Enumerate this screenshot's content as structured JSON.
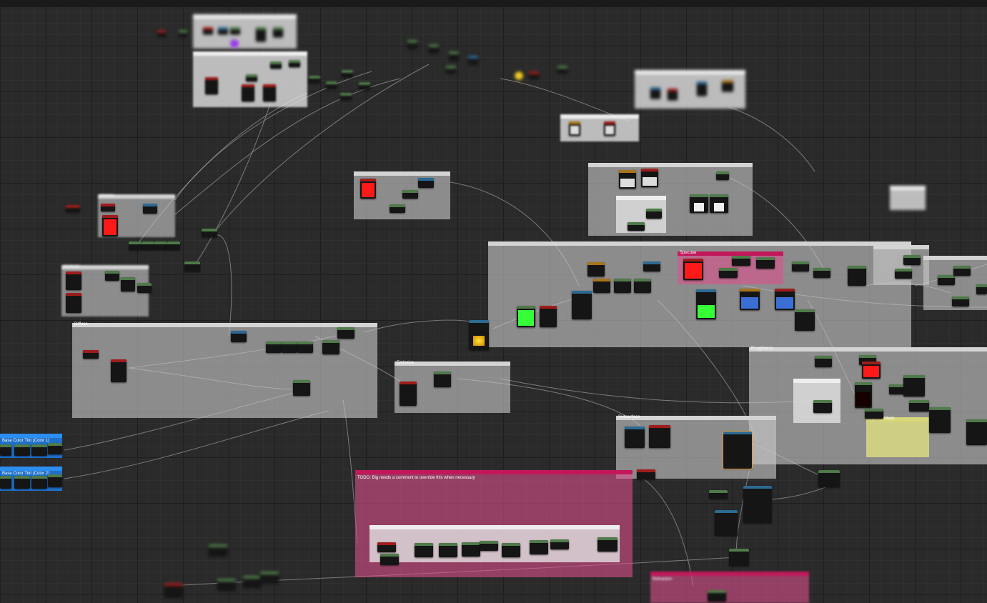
{
  "window": {
    "title": ""
  },
  "comments": {
    "c_main_left": "Diffuse",
    "c_far_left": "Normals",
    "c_params": "Metallic",
    "c_emissive": "Emissive",
    "c_right_big": "Specular",
    "c_bottom_small": "Subsurface",
    "c_right_lower": "Roughness",
    "c_yellow": "Opacity Mask",
    "c_pink_main": "TODO: Big needs a comment to override this when necessary",
    "c_blue_1": "Base Color Tint (Color 1)",
    "c_blue_2": "Base Color Tint (Color 2)",
    "c_pink_bottom": "Refraction"
  },
  "colors": {
    "accent_green": "#37ff37",
    "accent_red": "#ff1a1a",
    "accent_blue": "#3b6fd6",
    "accent_yellow": "#ffcf1a",
    "accent_purple": "#9b3ce8"
  }
}
